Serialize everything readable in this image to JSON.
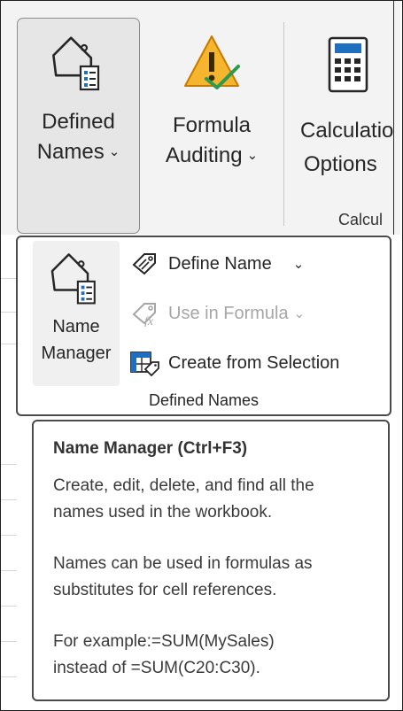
{
  "ribbon": {
    "defined_names_button": {
      "line1": "Defined",
      "line2": "Names",
      "icon": "tag-names-icon"
    },
    "formula_auditing_button": {
      "line1": "Formula",
      "line2": "Auditing",
      "icon": "warning-check-icon"
    },
    "calculation_options_button": {
      "line1": "Calculatio",
      "line2": "Options",
      "icon": "calculator-icon"
    },
    "calculation_group_label": "Calcul",
    "chevron": "⌄"
  },
  "dropdown": {
    "name_manager": {
      "line1": "Name",
      "line2": "Manager",
      "icon": "tag-names-icon"
    },
    "define_name": {
      "label": "Define Name",
      "icon": "tag-pencil-icon",
      "chevron": "⌄"
    },
    "use_in_formula": {
      "label": "Use in Formula",
      "icon": "tag-fx-icon",
      "chevron": "⌄",
      "disabled": true
    },
    "create_from_selection": {
      "label": "Create from Selection",
      "icon": "table-tag-icon"
    },
    "group_label": "Defined Names"
  },
  "tooltip": {
    "title": "Name Manager (Ctrl+F3)",
    "p1": "Create, edit, delete, and find all the names used in the workbook.",
    "p2": "Names can be used in formulas as substitutes for cell references.",
    "p3a": "For example:=SUM(MySales)",
    "p3b": "instead of =SUM(C20:C30)."
  },
  "colors": {
    "accent_blue": "#1f6fbf",
    "warning_yellow": "#f5b52e",
    "check_green": "#2e9a4e",
    "disabled_text": "#a6a6a6"
  }
}
